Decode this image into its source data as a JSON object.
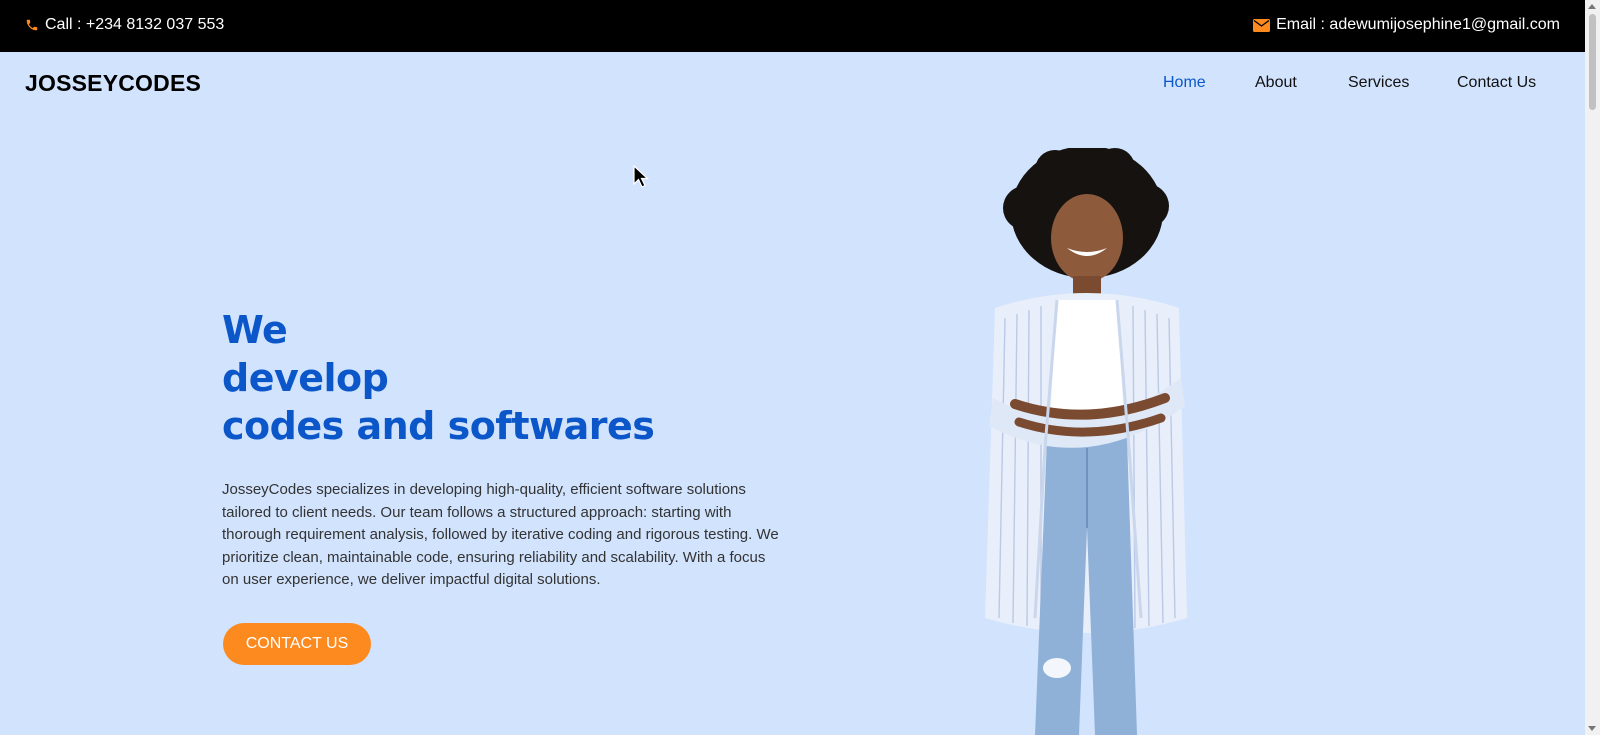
{
  "topbar": {
    "call_text": "Call : +234 8132 037 553",
    "email_text": "Email : adewumijosephine1@gmail.com",
    "icon_color": "#fd8a1f",
    "phone_icon": "phone-icon",
    "email_icon": "envelope-icon"
  },
  "brand": "JOSSEYCODES",
  "nav": {
    "items": [
      {
        "label": "Home",
        "active": true
      },
      {
        "label": "About",
        "active": false
      },
      {
        "label": "Services",
        "active": false
      },
      {
        "label": "Contact Us",
        "active": false
      }
    ]
  },
  "hero": {
    "title_lines": [
      "We",
      "develop",
      "codes and softwares"
    ],
    "description": "JosseyCodes specializes in developing high-quality, efficient software solutions tailored to client needs. Our team follows a structured approach: starting with thorough requirement analysis, followed by iterative coding and rigorous testing. We prioritize clean, maintainable code, ensuring reliability and scalability. With a focus on user experience, we deliver impactful digital solutions.",
    "cta_label": "CONTACT US"
  },
  "colors": {
    "background": "#d1e3fd",
    "accent": "#fd8a1f",
    "title": "#0b56c9",
    "nav_active": "#0a58ca"
  }
}
